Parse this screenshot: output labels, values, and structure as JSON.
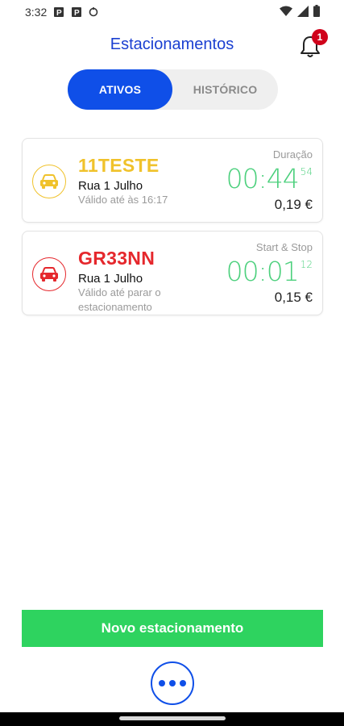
{
  "status_bar": {
    "time": "3:32",
    "icons": [
      "parking-notification-icon",
      "parking-notification-icon",
      "sync-icon",
      "wifi-icon",
      "signal-icon",
      "battery-icon"
    ]
  },
  "header": {
    "title": "Estacionamentos",
    "notification_count": "1"
  },
  "tabs": [
    {
      "label": "ATIVOS",
      "active": true
    },
    {
      "label": "HISTÓRICO",
      "active": false
    }
  ],
  "parkings": [
    {
      "plate": "11TESTE",
      "street": "Rua 1 Julho",
      "validity": "Válido até às 16:17",
      "timer_label": "Duração",
      "timer_main": "00:44",
      "timer_seconds": "54",
      "price": "0,19 €",
      "color": "#f0c22b"
    },
    {
      "plate": "GR33NN",
      "street": "Rua 1 Julho",
      "validity": "Válido até parar o estacionamento",
      "timer_label": "Start & Stop",
      "timer_main": "00:01",
      "timer_seconds": "12",
      "price": "0,15 €",
      "color": "#e5272c"
    }
  ],
  "actions": {
    "new_parking": "Novo estacionamento",
    "more_icon": "more-horizontal-icon"
  },
  "colors": {
    "primary": "#0f4fe8",
    "title": "#1a3fd1",
    "timer": "#4cd07d",
    "action": "#2ed35f",
    "badge": "#d0021b"
  }
}
